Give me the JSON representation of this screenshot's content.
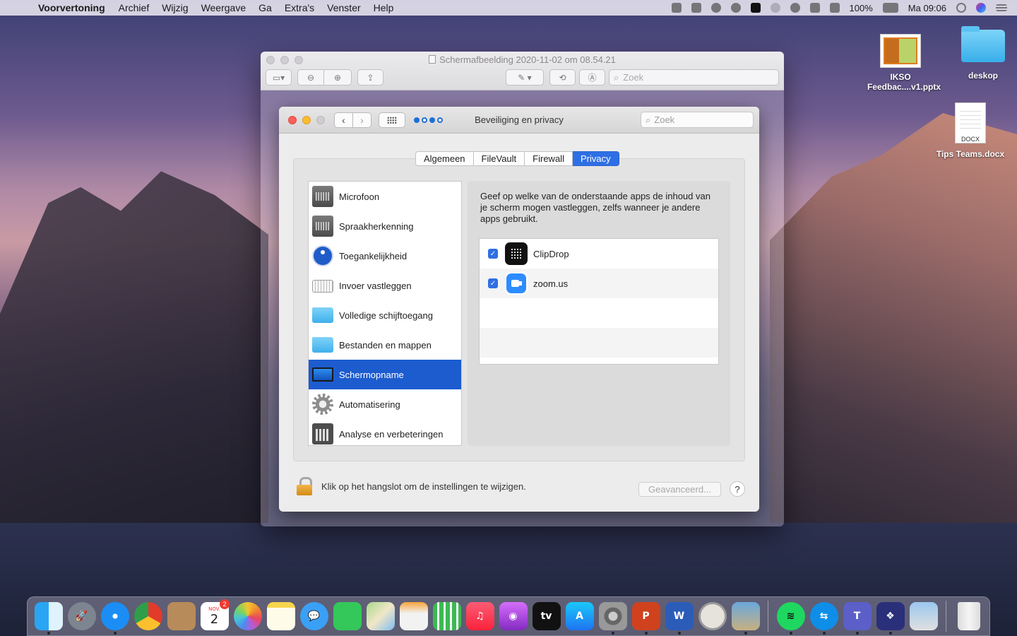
{
  "menubar": {
    "app_name": "Voorvertoning",
    "items": [
      "Archief",
      "Wijzig",
      "Weergave",
      "Ga",
      "Extra's",
      "Venster",
      "Help"
    ],
    "battery": "100%",
    "clock": "Ma 09:06"
  },
  "preview": {
    "title": "Schermafbeelding 2020-11-02 om 08.54.21",
    "search_placeholder": "Zoek"
  },
  "prefs": {
    "title": "Beveiliging en privacy",
    "search_placeholder": "Zoek",
    "tabs": [
      {
        "label": "Algemeen",
        "active": false
      },
      {
        "label": "FileVault",
        "active": false
      },
      {
        "label": "Firewall",
        "active": false
      },
      {
        "label": "Privacy",
        "active": true
      }
    ],
    "categories": [
      {
        "label": "Microfoon",
        "icon": "microphone-icon"
      },
      {
        "label": "Spraakherkenning",
        "icon": "speech-recognition-icon"
      },
      {
        "label": "Toegankelijkheid",
        "icon": "accessibility-icon"
      },
      {
        "label": "Invoer vastleggen",
        "icon": "keyboard-icon"
      },
      {
        "label": "Volledige schijftoegang",
        "icon": "folder-icon"
      },
      {
        "label": "Bestanden en mappen",
        "icon": "folder-icon"
      },
      {
        "label": "Schermopname",
        "icon": "screen-recording-icon",
        "selected": true
      },
      {
        "label": "Automatisering",
        "icon": "gear-icon"
      },
      {
        "label": "Analyse en verbeteringen",
        "icon": "analytics-icon"
      }
    ],
    "description": "Geef op welke van de onderstaande apps de inhoud van je scherm mogen vastleggen, zelfs wanneer je andere apps gebruikt.",
    "apps": [
      {
        "name": "ClipDrop",
        "checked": true,
        "icon": "clipdrop-icon"
      },
      {
        "name": "zoom.us",
        "checked": true,
        "icon": "zoom-icon"
      }
    ],
    "lock_text": "Klik op het hangslot om de instellingen te wijzigen.",
    "advanced_label": "Geavanceerd...",
    "help_label": "?"
  },
  "desktop": {
    "items": [
      {
        "label": "IKSO Feedbac....v1.pptx",
        "type": "pptx"
      },
      {
        "label": "deskop",
        "type": "folder"
      },
      {
        "label": "Tips Teams.docx",
        "type": "docx",
        "badge": "DOCX"
      }
    ]
  },
  "dock": {
    "calendar_month": "NOV.",
    "calendar_day": "2",
    "calendar_badge": "2",
    "tv_label": "tv",
    "powerpoint_letter": "P",
    "word_letter": "W",
    "teams_letter": "T"
  },
  "colors": {
    "accent": "#2f6fe4",
    "selection": "#1c5ccf"
  }
}
